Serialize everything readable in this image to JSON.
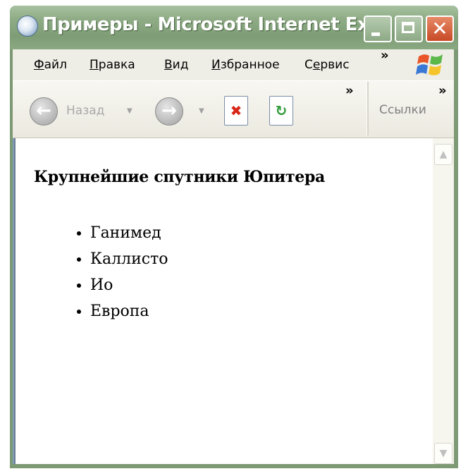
{
  "window": {
    "title": "Примеры - Microsoft Internet Ex...",
    "icon": "ie-globe-icon",
    "controls": {
      "minimize_icon": "minimize-icon",
      "maximize_icon": "maximize-icon",
      "close_icon": "close-icon"
    }
  },
  "menu": {
    "items": [
      {
        "label": "Файл",
        "accel": "Ф",
        "rest": "айл"
      },
      {
        "label": "Правка",
        "accel": "П",
        "rest": "равка"
      },
      {
        "label": "Вид",
        "accel": "В",
        "rest": "ид"
      },
      {
        "label": "Избранное",
        "accel": "И",
        "rest": "збранное"
      },
      {
        "label": "Сервис",
        "accel_prefix": "С",
        "accel": "е",
        "rest": "рвис"
      }
    ],
    "overflow": "»"
  },
  "toolbar": {
    "back_label": "Назад",
    "back_icon": "back-arrow-icon",
    "forward_icon": "forward-arrow-icon",
    "stop_icon": "stop-icon",
    "refresh_icon": "refresh-icon",
    "overflow": "»",
    "links_label": "Ссылки",
    "links_overflow": "»"
  },
  "page": {
    "heading": "Крупнейшие спутники Юпитера",
    "moons": [
      "Ганимед",
      "Каллисто",
      "Ио",
      "Европа"
    ]
  },
  "colors": {
    "titlebar": "#8fac86",
    "close_button": "#c84a26",
    "menubar": "#efeee6"
  }
}
